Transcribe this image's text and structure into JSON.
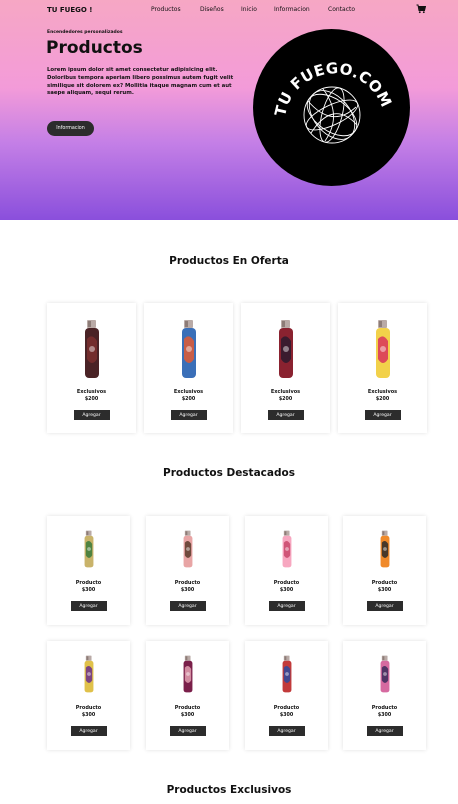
{
  "header": {
    "brand": "TU FUEGO !",
    "nav": [
      "Productos",
      "Diseños",
      "Inicio",
      "Informacion",
      "Contacto"
    ]
  },
  "hero": {
    "kicker": "Encendedores personalizados",
    "title": "Productos",
    "text": "Lorem ipsum dolor sit amet consectetur adipisicing elit. Doloribus tempora aperiam libero possimus autem fugit velit similique sit dolorem ex? Mollitia itaque magnam cum et aut saepe aliquam, sequi rerum.",
    "button": "Informacion",
    "logo_text": "TU FUEGO.COM"
  },
  "sections": {
    "offer_title": "Productos En Oferta",
    "featured_title": "Productos Destacados",
    "exclusive_title": "Productos Exclusivos"
  },
  "offer_products": [
    {
      "name": "Exclusivos",
      "price": "$200",
      "button": "Agregar",
      "body": "#4a2326",
      "art": "#7a2f2f"
    },
    {
      "name": "Exclusivos",
      "price": "$200",
      "button": "Agregar",
      "body": "#3a6fb8",
      "art": "#e25a33"
    },
    {
      "name": "Exclusivos",
      "price": "$200",
      "button": "Agregar",
      "body": "#8a2230",
      "art": "#2b1a2e"
    },
    {
      "name": "Exclusivos",
      "price": "$200",
      "button": "Agregar",
      "body": "#f2d14a",
      "art": "#d9325a"
    }
  ],
  "featured_products": [
    {
      "name": "Producto",
      "price": "$300",
      "button": "Agregar",
      "body": "#c9b36a",
      "art": "#3a7a3a"
    },
    {
      "name": "Producto",
      "price": "$300",
      "button": "Agregar",
      "body": "#e8a5a5",
      "art": "#5a3a2a"
    },
    {
      "name": "Producto",
      "price": "$300",
      "button": "Agregar",
      "body": "#f7a7c0",
      "art": "#c9476b"
    },
    {
      "name": "Producto",
      "price": "$300",
      "button": "Agregar",
      "body": "#f08a2a",
      "art": "#2a2a2a"
    },
    {
      "name": "Producto",
      "price": "$300",
      "button": "Agregar",
      "body": "#e0c14a",
      "art": "#6a2e8a"
    },
    {
      "name": "Producto",
      "price": "$300",
      "button": "Agregar",
      "body": "#7a1f4a",
      "art": "#e2a0b0"
    },
    {
      "name": "Producto",
      "price": "$300",
      "button": "Agregar",
      "body": "#c23a3a",
      "art": "#2a4aa0"
    },
    {
      "name": "Producto",
      "price": "$300",
      "button": "Agregar",
      "body": "#d66aa0",
      "art": "#3a2a5a"
    }
  ],
  "icons": {
    "cart": "cart-icon"
  }
}
